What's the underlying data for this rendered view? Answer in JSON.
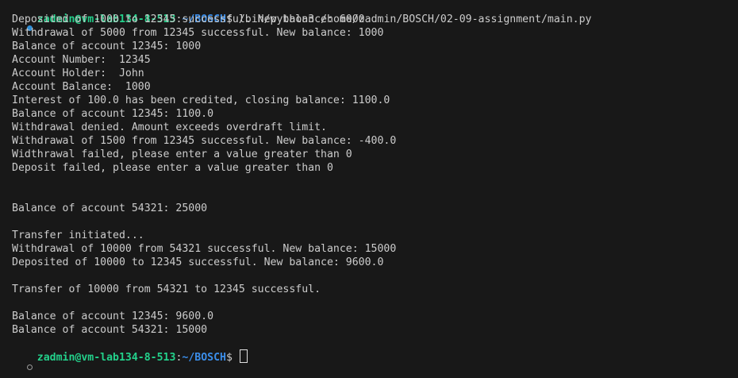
{
  "prompt": {
    "user_host": "zadmin@vm-lab134-8-513",
    "separator": ":",
    "path": "~/BOSCH",
    "symbol": "$ "
  },
  "command": "/bin/python3 /home/zadmin/BOSCH/02-09-assignment/main.py",
  "output": [
    "Deposited of 1000 to 12345 successful. New balance: 6000",
    "Withdrawal of 5000 from 12345 successful. New balance: 1000",
    "Balance of account 12345: 1000",
    "Account Number:  12345",
    "Account Holder:  John",
    "Account Balance:  1000",
    "Interest of 100.0 has been credited, closing balance: 1100.0",
    "Balance of account 12345: 1100.0",
    "Withdrawal denied. Amount exceeds overdraft limit.",
    "Withdrawal of 1500 from 12345 successful. New balance: -400.0",
    "Widthrawal failed, please enter a value greater than 0",
    "Deposit failed, please enter a value greater than 0",
    "",
    "",
    "Balance of account 54321: 25000",
    "",
    "Transfer initiated...",
    "Withdrawal of 10000 from 54321 successful. New balance: 15000",
    "Deposited of 10000 to 12345 successful. New balance: 9600.0",
    "",
    "Transfer of 10000 from 54321 to 12345 successful.",
    "",
    "Balance of account 12345: 9600.0",
    "Balance of account 54321: 15000"
  ],
  "colors": {
    "background": "#181818",
    "text": "#cccccc",
    "user_host": "#23d18b",
    "path": "#3b8eea",
    "success_dot": "#2f8fd8"
  }
}
